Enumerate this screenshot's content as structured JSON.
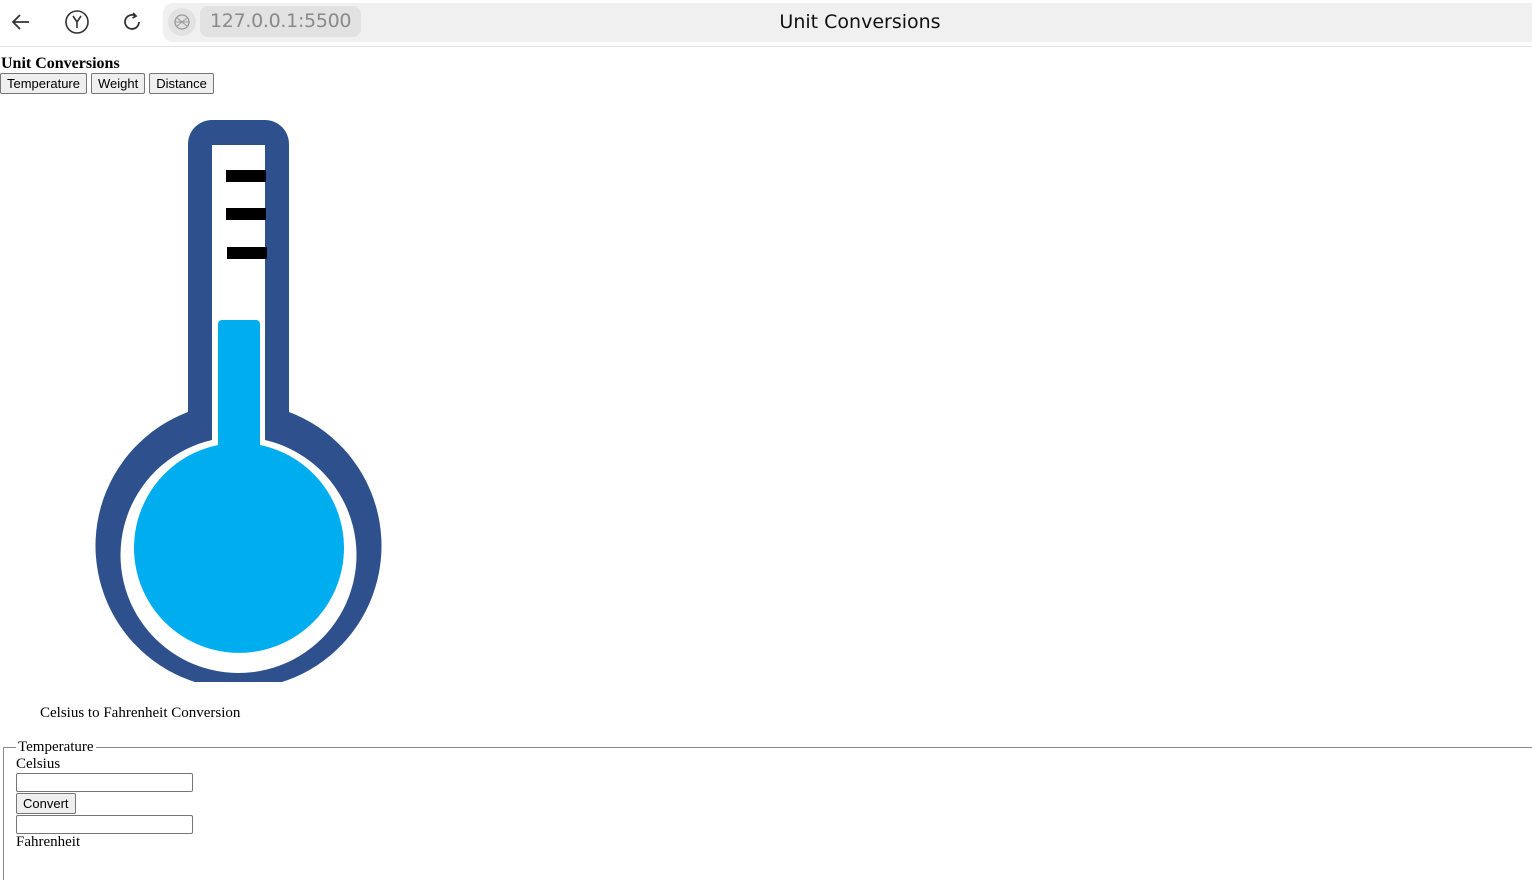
{
  "browser": {
    "url": "127.0.0.1:5500",
    "tab_title": "Unit Conversions"
  },
  "page": {
    "title": "Unit Conversions",
    "tabs": [
      {
        "label": "Temperature"
      },
      {
        "label": "Weight"
      },
      {
        "label": "Distance"
      }
    ],
    "caption": "Celsius to Fahrenheit Conversion",
    "form": {
      "legend": "Temperature",
      "input_label": "Celsius",
      "input_value": "",
      "convert_label": "Convert",
      "output_value": "",
      "output_label": "Fahrenheit"
    },
    "thermometer": {
      "outline_color": "#2e518e",
      "fill_color": "#00aeef",
      "tick_color": "#000000"
    }
  }
}
